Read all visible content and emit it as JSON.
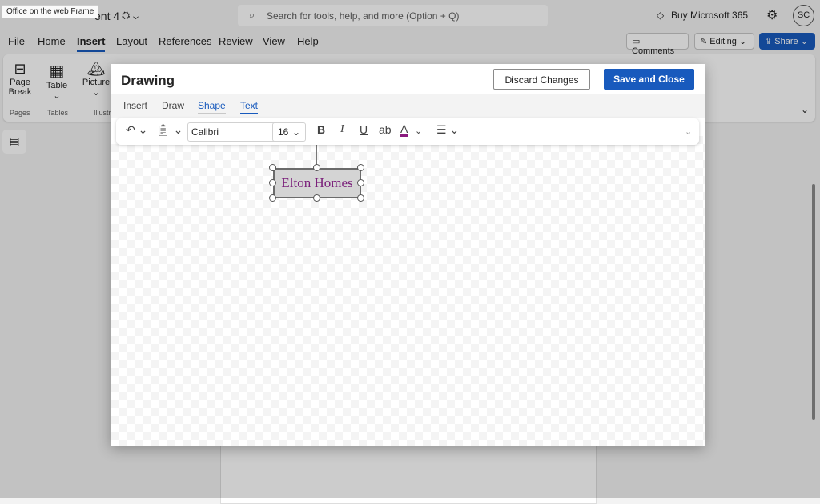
{
  "tooltip": "Office on the web Frame",
  "header": {
    "doc_title": "ent 4",
    "search_placeholder": "Search for tools, help, and more (Option + Q)",
    "buy": "Buy Microsoft 365",
    "avatar": "SC"
  },
  "menu": [
    "File",
    "Home",
    "Insert",
    "Layout",
    "References",
    "Review",
    "View",
    "Help"
  ],
  "actions": {
    "comments": "Comments",
    "editing": "Editing",
    "share": "Share"
  },
  "ribbon": {
    "page_break": [
      "Page",
      "Break"
    ],
    "table": "Table",
    "picture": "Picture",
    "groups": [
      "Pages",
      "Tables",
      "Illustr"
    ]
  },
  "dialog": {
    "title": "Drawing",
    "discard": "Discard Changes",
    "save": "Save and Close",
    "tabs": [
      "Insert",
      "Draw",
      "Shape",
      "Text"
    ],
    "active_tab": "Text",
    "toolbar": {
      "font": "Calibri",
      "size": "16",
      "bold": "B",
      "italic": "I",
      "underline": "U",
      "strike": "ab",
      "font_color_label": "A",
      "font_color": "#8b1a7e"
    },
    "shape_text": "Elton Homes",
    "shape_text_color": "#7a1f7a",
    "accent": "#185abd"
  }
}
